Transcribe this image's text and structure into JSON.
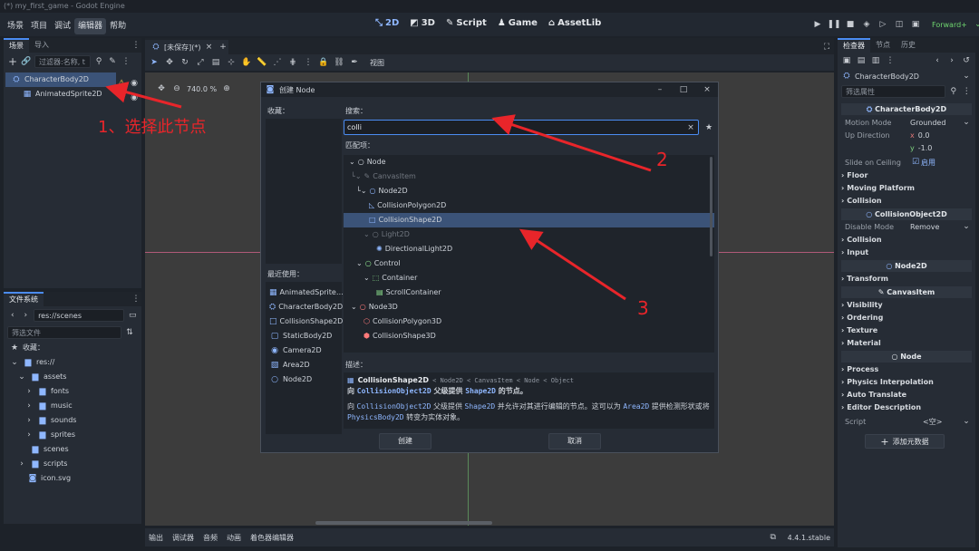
{
  "window": {
    "title": "(*) my_first_game - Godot Engine"
  },
  "menu": {
    "items": [
      "场景",
      "项目",
      "调试",
      "编辑器",
      "帮助"
    ],
    "active": "编辑器"
  },
  "modes": {
    "2d": "2D",
    "3d": "3D",
    "script": "Script",
    "game": "Game",
    "assetlib": "AssetLib"
  },
  "renderer": "Forward+",
  "scene_dock": {
    "tabs": [
      "场景",
      "导入"
    ],
    "filter_placeholder": "过滤器:名称, t",
    "nodes": [
      {
        "name": "CharacterBody2D",
        "selected": true,
        "warning": true
      },
      {
        "name": "AnimatedSprite2D"
      }
    ]
  },
  "filesystem": {
    "tab": "文件系统",
    "path": "res://scenes",
    "filter_placeholder": "筛选文件",
    "favorites": "收藏：",
    "root": "res://",
    "items": [
      "assets",
      "fonts",
      "music",
      "sounds",
      "sprites",
      "scenes",
      "scripts",
      "icon.svg"
    ]
  },
  "editor": {
    "scene_tab": "[未保存](*)",
    "zoom": "740.0 %",
    "view_menu": "视图"
  },
  "bottom": {
    "tabs": [
      "输出",
      "调试器",
      "音频",
      "动画",
      "着色器编辑器"
    ],
    "version": "4.4.1.stable"
  },
  "dialog": {
    "title": "创建 Node",
    "favorites_label": "收藏：",
    "recent_label": "最近使用：",
    "recent": [
      "AnimatedSprite…",
      "CharacterBody2D",
      "CollisionShape2D",
      "StaticBody2D",
      "Camera2D",
      "Area2D",
      "Node2D"
    ],
    "search_label": "搜索：",
    "search_value": "colli",
    "matches_label": "匹配项：",
    "tree": [
      {
        "name": "Node",
        "indent": 0,
        "dim": false
      },
      {
        "name": "CanvasItem",
        "indent": 1,
        "dim": true
      },
      {
        "name": "Node2D",
        "indent": 2,
        "dim": false
      },
      {
        "name": "CollisionPolygon2D",
        "indent": 3,
        "dim": false
      },
      {
        "name": "CollisionShape2D",
        "indent": 3,
        "dim": false,
        "selected": true
      },
      {
        "name": "Light2D",
        "indent": 3,
        "dim": true
      },
      {
        "name": "DirectionalLight2D",
        "indent": 4,
        "dim": false
      },
      {
        "name": "Control",
        "indent": 2,
        "dim": false
      },
      {
        "name": "Container",
        "indent": 3,
        "dim": false
      },
      {
        "name": "ScrollContainer",
        "indent": 4,
        "dim": false
      },
      {
        "name": "Node3D",
        "indent": 1,
        "dim": false
      },
      {
        "name": "CollisionPolygon3D",
        "indent": 2,
        "dim": false
      },
      {
        "name": "CollisionShape3D",
        "indent": 2,
        "dim": false
      }
    ],
    "desc_label": "描述：",
    "desc_path": {
      "class": "CollisionShape2D",
      "chain": "< Node2D < CanvasItem < Node < Object"
    },
    "desc_line1": {
      "pre": "向 ",
      "c1": "CollisionObject2D",
      "mid": " 父级提供 ",
      "c2": "Shape2D",
      "post": " 的节点。"
    },
    "desc_line2": {
      "pre": "向 ",
      "c1": "CollisionObject2D",
      "mid": " 父级提供 ",
      "c2": "Shape2D",
      "mid2": " 并允许对其进行编辑的节点。这可以为 ",
      "c3": "Area2D",
      "post": " 提供检测形状或将"
    },
    "desc_line3": {
      "c1": "PhysicsBody2D",
      "post": " 转变为实体对象。"
    },
    "create_button": "创建",
    "cancel_button": "取消"
  },
  "inspector": {
    "tabs": [
      "检查器",
      "节点",
      "历史"
    ],
    "object": "CharacterBody2D",
    "filter_placeholder": "筛选属性",
    "class_header": "CharacterBody2D",
    "motion_mode_label": "Motion Mode",
    "motion_mode_value": "Grounded",
    "up_direction_label": "Up Direction",
    "up_x": "0.0",
    "up_y": "-1.0",
    "slide_label": "Slide on Ceiling",
    "slide_value": "启用",
    "groups1": [
      "Floor",
      "Moving Platform",
      "Collision"
    ],
    "co2d_header": "CollisionObject2D",
    "disable_mode_label": "Disable Mode",
    "disable_mode_value": "Remove",
    "groups2": [
      "Collision",
      "Input"
    ],
    "node2d_header": "Node2D",
    "groups3": [
      "Transform"
    ],
    "canvas_header": "CanvasItem",
    "groups4": [
      "Visibility",
      "Ordering",
      "Texture",
      "Material"
    ],
    "node_header": "Node",
    "groups5": [
      "Process",
      "Physics Interpolation",
      "Auto Translate",
      "Editor Description"
    ],
    "script_label": "Script",
    "script_value": "<空>",
    "add_metadata": "添加元数据"
  },
  "annotations": {
    "step1": "1、选择此节点",
    "step2": "2",
    "step3": "3"
  },
  "colors": {
    "accent": "#4b8cf2",
    "annotation": "#e8252a",
    "selection": "#3b5378"
  }
}
